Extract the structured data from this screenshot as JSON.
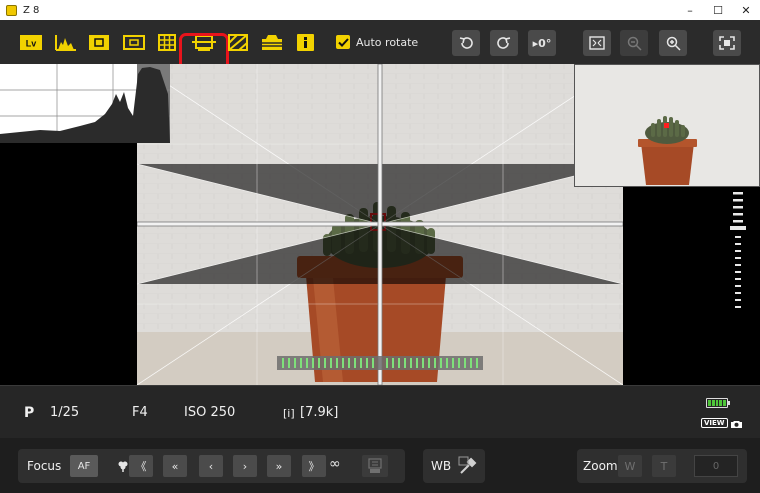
{
  "window": {
    "title": "Z 8",
    "minimize_glyph": "–",
    "maximize_glyph": "☐",
    "close_glyph": "✕"
  },
  "toolbar": {
    "lv_label": "Lv",
    "autorotate_label": "Auto rotate",
    "autorotate_checked": true,
    "rotate_angle_label": "▸0°",
    "highlight_color": "#e8141c",
    "accent_color": "#f2d200"
  },
  "info": {
    "mode": "P",
    "shutter": "1/25",
    "aperture": "F4",
    "iso": "ISO 250",
    "shots_remaining": "[7.9k]",
    "shots_icon_glyph": "[i]",
    "view_badge": "VIEW"
  },
  "focus": {
    "label": "Focus",
    "af_label": "AF",
    "near_fast": "《",
    "near_medium": "«",
    "near_slow": "‹",
    "far_slow": "›",
    "far_medium": "»",
    "far_fast": "》",
    "infinity": "∞"
  },
  "wb": {
    "label": "WB"
  },
  "zoom": {
    "label": "Zoom",
    "wide": "W",
    "tele": "T",
    "value": "0"
  }
}
